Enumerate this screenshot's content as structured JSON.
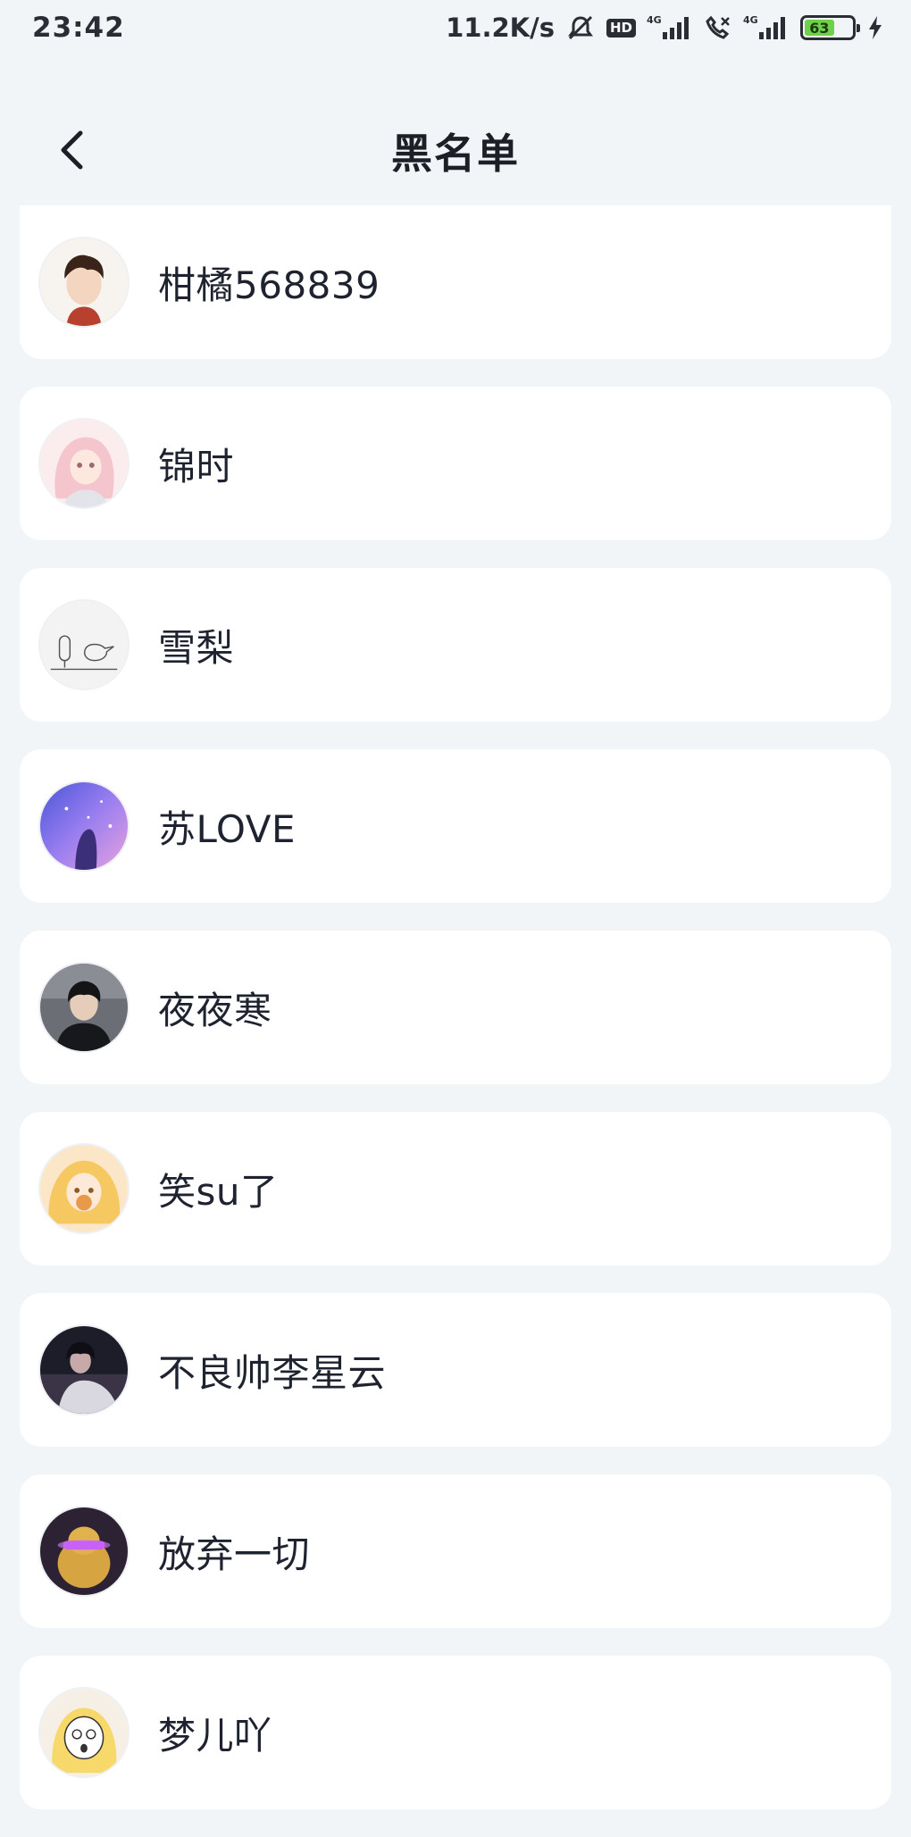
{
  "status_bar": {
    "time": "23:42",
    "net_speed": "11.2K/s",
    "hd_label": "HD",
    "battery_level": "63",
    "battery_percent": 63,
    "icons": [
      "mute-bell-icon",
      "hd-icon",
      "signal-4g-icon",
      "call-blocked-icon",
      "signal-4g-icon",
      "battery-icon",
      "charging-icon"
    ]
  },
  "header": {
    "title": "黑名单",
    "back_icon": "chevron-left-icon"
  },
  "blacklist": [
    {
      "name": "柑橘568839",
      "avatar": "avatar-boy-cartoon"
    },
    {
      "name": "锦时",
      "avatar": "avatar-pink-anime"
    },
    {
      "name": "雪梨",
      "avatar": "avatar-sketch"
    },
    {
      "name": "苏LOVE",
      "avatar": "avatar-purple-galaxy"
    },
    {
      "name": "夜夜寒",
      "avatar": "avatar-dark-portrait"
    },
    {
      "name": "笑su了",
      "avatar": "avatar-blonde-anime"
    },
    {
      "name": "不良帅李星云",
      "avatar": "avatar-dark-figure"
    },
    {
      "name": "放弃一切",
      "avatar": "avatar-glowing-duck"
    },
    {
      "name": "梦儿吖",
      "avatar": "avatar-cartoon-girl"
    }
  ],
  "colors": {
    "background": "#f2f5f8",
    "card": "#ffffff",
    "text": "#1f2330",
    "battery": "#6fd14a"
  }
}
